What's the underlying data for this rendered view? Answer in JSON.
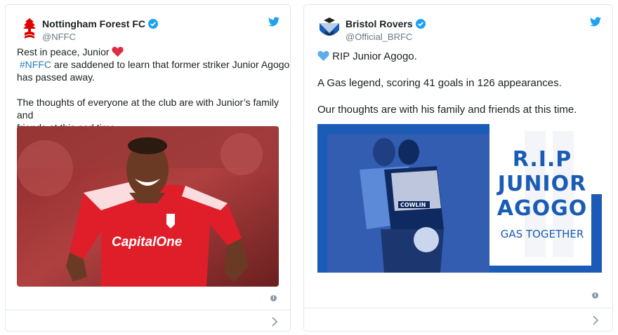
{
  "tweets": [
    {
      "name": "Nottingham Forest FC",
      "handle": "@NFFC",
      "avatar_icon": "forest-tree-crest",
      "line1": "Rest in peace, Junior",
      "hashtag": "#NFFC",
      "line2_rest": " are saddened to learn that former striker Junior Agogo",
      "line3": "has passed away.",
      "line4": "The thoughts of everyone at the club are with Junior’s family and",
      "line5": "friends at this sad time.",
      "shirt_sponsor": "CapitalOne",
      "emoji": "red-heart",
      "accent": "#2b7bb9"
    },
    {
      "name": "Bristol Rovers",
      "handle": "@Official_BRFC",
      "avatar_icon": "bristol-rovers-crest",
      "emoji": "blue-heart",
      "line1": "RIP Junior Agogo.",
      "line2": "A Gas legend, scoring 41 goals in 126 appearances.",
      "line3": "Our thoughts are with his family and friends at this time.",
      "graphic": {
        "rip": "R.I.P",
        "first": "JUNIOR",
        "last": "AGOGO",
        "tagline": "GAS TOGETHER",
        "shirt_sponsor": "COWLIN",
        "brand_color": "#1a5bb5"
      }
    }
  ]
}
